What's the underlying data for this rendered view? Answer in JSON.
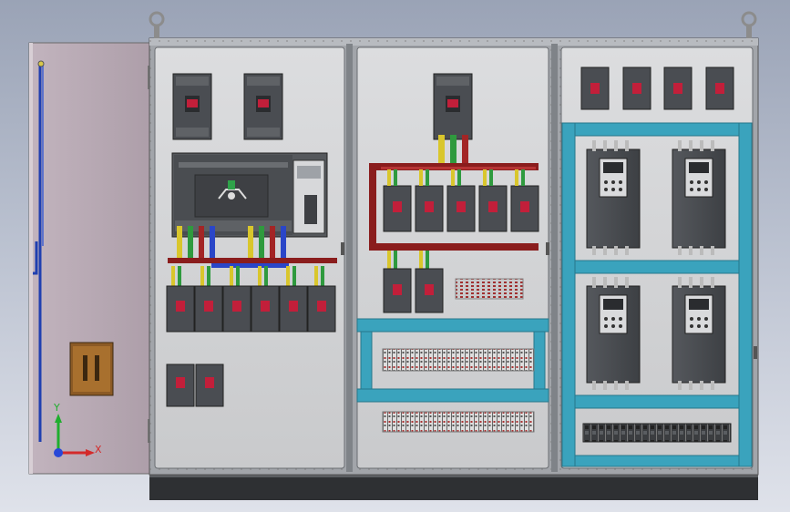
{
  "viewport": {
    "title": "",
    "view": "front",
    "colors": {
      "background_top": "#9aa3b6",
      "background_bottom": "#dfe2ea",
      "cabinet_frame": "#8e9298",
      "panel_plate": "#d3d4d6",
      "door_fill": "#b8a9b3",
      "busbar_red": "#8a1d1d",
      "cable_duct": "#3aa3bd",
      "device_dark": "#4a4d52",
      "plinth": "#2e3033"
    },
    "icons": {
      "lifting_eye": "lifting-eye-icon",
      "triad": "coordinate-triad-icon"
    }
  },
  "triad": {
    "x_label": "X",
    "y_label": "Y"
  }
}
